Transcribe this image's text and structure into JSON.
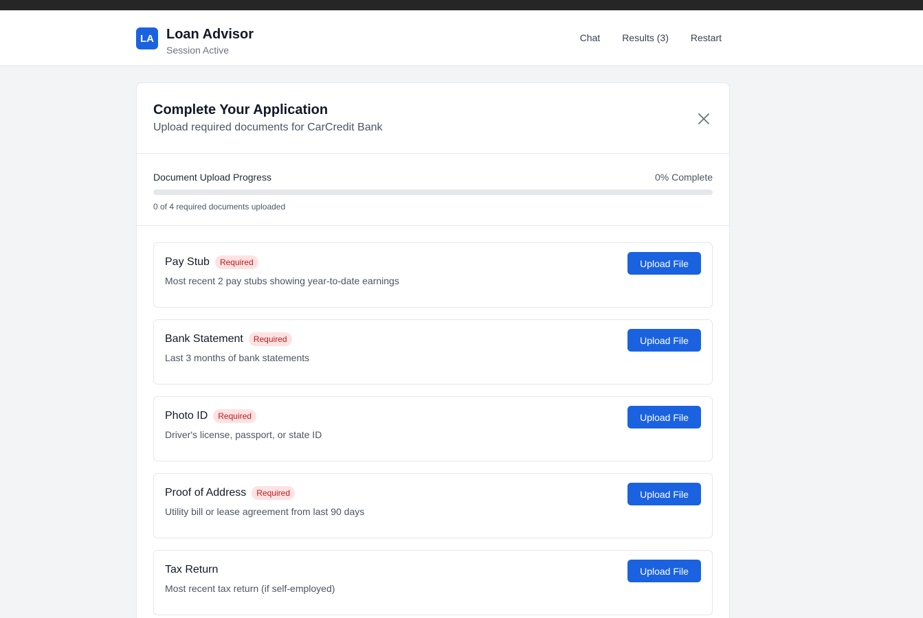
{
  "header": {
    "logo_initials": "LA",
    "title": "Loan Advisor",
    "status": "Session Active",
    "nav": {
      "chat": "Chat",
      "results": "Results (3)",
      "restart": "Restart"
    }
  },
  "modal": {
    "title": "Complete Your Application",
    "subtitle": "Upload required documents for CarCredit Bank",
    "progress": {
      "label": "Document Upload Progress",
      "percent_text": "0% Complete",
      "percent": 0,
      "count_text": "0 of 4 required documents uploaded"
    },
    "documents": [
      {
        "title": "Pay Stub",
        "badge": "Required",
        "description": "Most recent 2 pay stubs showing year-to-date earnings",
        "button": "Upload File"
      },
      {
        "title": "Bank Statement",
        "badge": "Required",
        "description": "Last 3 months of bank statements",
        "button": "Upload File"
      },
      {
        "title": "Photo ID",
        "badge": "Required",
        "description": "Driver's license, passport, or state ID",
        "button": "Upload File"
      },
      {
        "title": "Proof of Address",
        "badge": "Required",
        "description": "Utility bill or lease agreement from last 90 days",
        "button": "Upload File"
      },
      {
        "title": "Tax Return",
        "badge": "",
        "description": "Most recent tax return (if self-employed)",
        "button": "Upload File"
      }
    ]
  },
  "colors": {
    "accent": "#1a62e0",
    "badge_bg": "#fee2e2",
    "badge_text": "#b91c1c"
  },
  "icons": {
    "close": "close-icon"
  }
}
